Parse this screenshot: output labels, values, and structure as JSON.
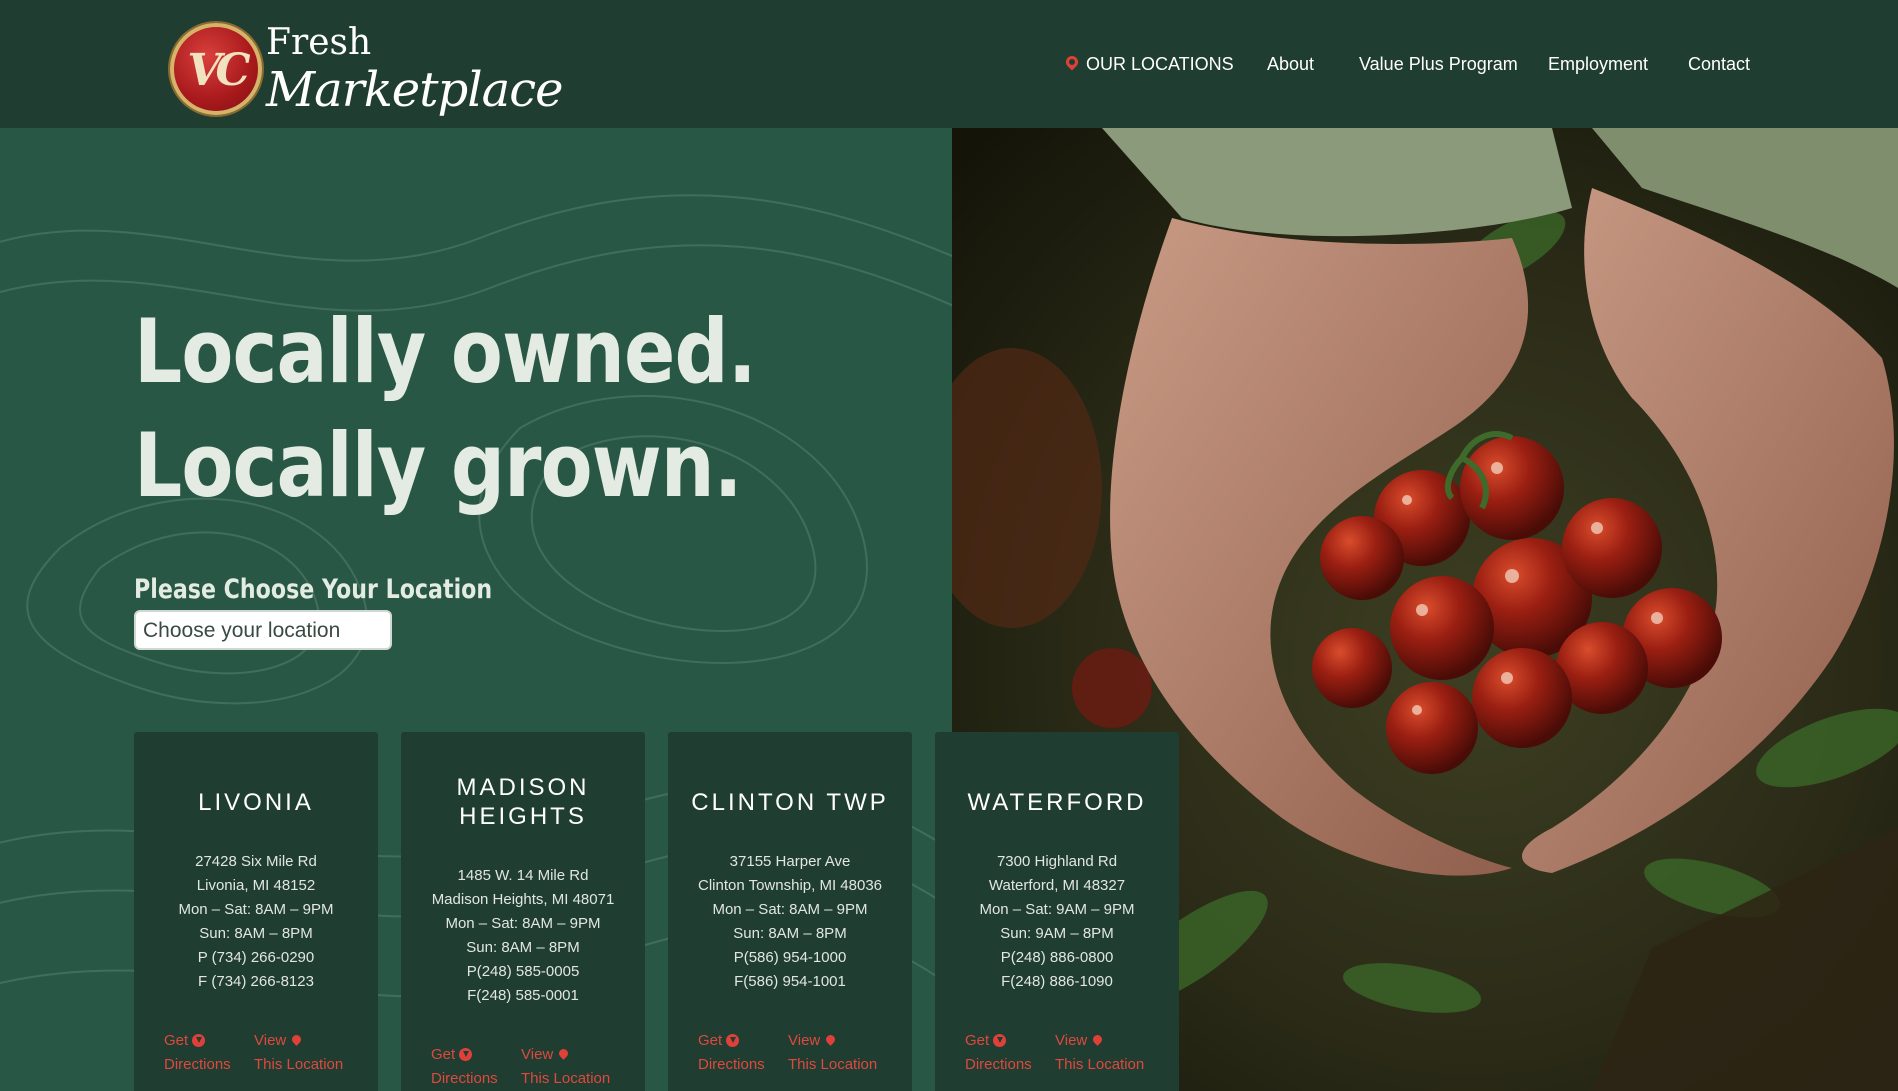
{
  "header": {
    "logo": {
      "initials": "VC",
      "line1": "Fresh",
      "line2": "Marketplace"
    },
    "nav": [
      {
        "label": "OUR LOCATIONS"
      },
      {
        "label": "About"
      },
      {
        "label": "Value Plus Program"
      },
      {
        "label": "Employment"
      },
      {
        "label": "Contact"
      }
    ]
  },
  "hero": {
    "headline_line1": "Locally owned.",
    "headline_line2": "Locally grown.",
    "choose_label": "Please Choose Your Location",
    "select_placeholder": "Choose your location"
  },
  "locations": [
    {
      "name": "LIVONIA",
      "lines": [
        "27428 Six Mile Rd",
        "Livonia, MI 48152",
        "Mon – Sat: 8AM – 9PM",
        "Sun: 8AM – 8PM",
        "P (734) 266-0290",
        "F (734) 266-8123"
      ],
      "directions": [
        "Get",
        "Directions"
      ],
      "view": [
        "View",
        "This Location"
      ]
    },
    {
      "name": "MADISON HEIGHTS",
      "name_line1": "MADISON",
      "name_line2": "HEIGHTS",
      "lines": [
        "1485 W. 14 Mile Rd",
        "Madison Heights, MI 48071",
        "Mon – Sat: 8AM – 9PM",
        "Sun: 8AM – 8PM",
        "P(248) 585-0005",
        "F(248) 585-0001"
      ],
      "directions": [
        "Get",
        "Directions"
      ],
      "view": [
        "View",
        "This Location"
      ]
    },
    {
      "name": "CLINTON TWP",
      "lines": [
        "37155 Harper Ave",
        "Clinton Township, MI 48036",
        "Mon – Sat: 8AM – 9PM",
        "Sun: 8AM – 8PM",
        "P(586) 954-1000",
        "F(586) 954-1001"
      ],
      "directions": [
        "Get",
        "Directions"
      ],
      "view": [
        "View",
        "This Location"
      ]
    },
    {
      "name": "WATERFORD",
      "lines": [
        "7300 Highland Rd",
        "Waterford, MI 48327",
        "Mon – Sat: 9AM – 9PM",
        "Sun: 9AM – 8PM",
        "P(248) 886-0800",
        "F(248) 886-1090"
      ],
      "directions": [
        "Get",
        "Directions"
      ],
      "view": [
        "View",
        "This Location"
      ]
    }
  ],
  "colors": {
    "header_bg": "#1f3d31",
    "hero_bg": "#285845",
    "card_bg": "#1f3d31",
    "accent": "#e0403a"
  }
}
